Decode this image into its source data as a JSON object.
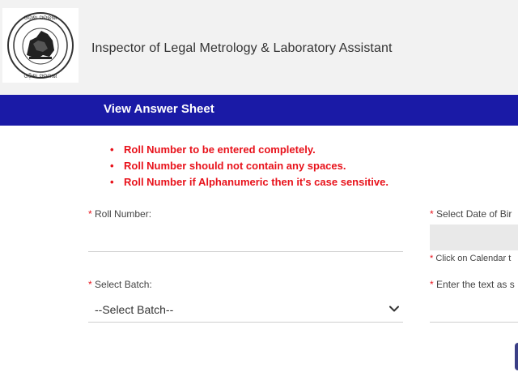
{
  "header": {
    "emblem_text_top": "ଓଡ଼ିଶା ସରକାର",
    "emblem_text_bottom": "ଓଡ଼ିଶା ସରକାର",
    "site_title": "Inspector of Legal Metrology & Laboratory Assistant"
  },
  "title_bar": {
    "page_title": "View Answer Sheet"
  },
  "instructions": [
    "Roll Number to be entered completely.",
    "Roll Number should not contain any spaces.",
    "Roll Number if Alphanumeric then it's case sensitive."
  ],
  "form": {
    "required_marker": "*",
    "roll_number": {
      "label": "Roll Number:",
      "value": ""
    },
    "date_of_birth": {
      "label": "Select Date of Bir",
      "hint": "Click on Calendar t",
      "value": ""
    },
    "batch": {
      "label": "Select Batch:",
      "selected": "--Select Batch--"
    },
    "captcha": {
      "label": "Enter the text as s",
      "value": ""
    }
  },
  "colors": {
    "title_bar": "#1a1aa6",
    "instruction_red": "#e8121b",
    "header_bg": "#f2f2f2"
  }
}
